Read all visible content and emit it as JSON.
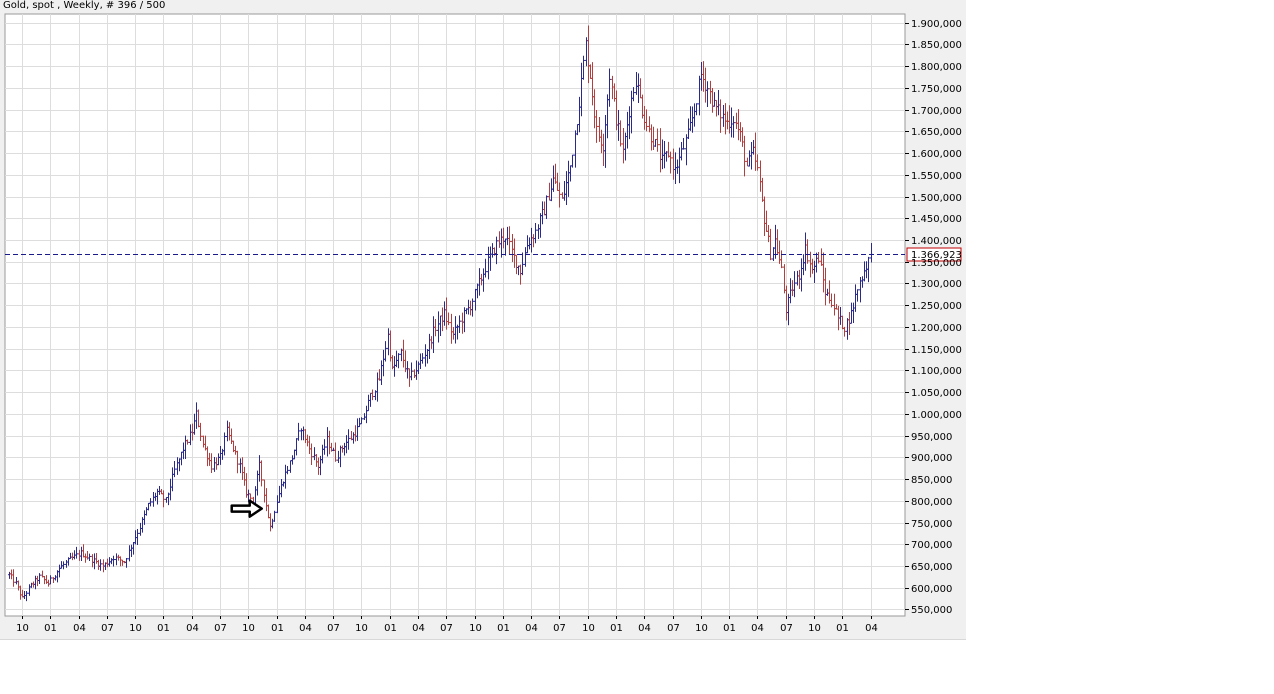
{
  "chart_title": "Gold, spot , Weekly, # 396 / 500",
  "colors": {
    "up_bar": "#2a2a8a",
    "down_bar": "#b04040",
    "grid": "#dddddd",
    "current_line": "#1a1a8c",
    "current_box_border": "#c00000"
  },
  "arrow_annotation": {
    "icon": "right-arrow-icon",
    "x_index": 118,
    "value": 782000
  },
  "chart_data": {
    "type": "ohlc",
    "title": "Gold, spot , Weekly, # 396 / 500",
    "ylim": [
      535000,
      1920000
    ],
    "y_ticks": [
      {
        "value": 550000,
        "label": "550,000"
      },
      {
        "value": 600000,
        "label": "600,000"
      },
      {
        "value": 650000,
        "label": "650,000"
      },
      {
        "value": 700000,
        "label": "700,000"
      },
      {
        "value": 750000,
        "label": "750,000"
      },
      {
        "value": 800000,
        "label": "800,000"
      },
      {
        "value": 850000,
        "label": "850,000"
      },
      {
        "value": 900000,
        "label": "900,000"
      },
      {
        "value": 950000,
        "label": "950,000"
      },
      {
        "value": 1000000,
        "label": "1.000,000"
      },
      {
        "value": 1050000,
        "label": "1.050,000"
      },
      {
        "value": 1100000,
        "label": "1.100,000"
      },
      {
        "value": 1150000,
        "label": "1.150,000"
      },
      {
        "value": 1200000,
        "label": "1.200,000"
      },
      {
        "value": 1250000,
        "label": "1.250,000"
      },
      {
        "value": 1300000,
        "label": "1.300,000"
      },
      {
        "value": 1350000,
        "label": "1.350,000"
      },
      {
        "value": 1400000,
        "label": "1.400,000"
      },
      {
        "value": 1450000,
        "label": "1.450,000"
      },
      {
        "value": 1500000,
        "label": "1.500,000"
      },
      {
        "value": 1550000,
        "label": "1.550,000"
      },
      {
        "value": 1600000,
        "label": "1.600,000"
      },
      {
        "value": 1650000,
        "label": "1.650,000"
      },
      {
        "value": 1700000,
        "label": "1.700,000"
      },
      {
        "value": 1750000,
        "label": "1.750,000"
      },
      {
        "value": 1800000,
        "label": "1.800,000"
      },
      {
        "value": 1850000,
        "label": "1.850,000"
      },
      {
        "value": 1900000,
        "label": "1.900,000"
      }
    ],
    "x_ticks": [
      {
        "index": 6,
        "label": "10"
      },
      {
        "index": 19,
        "label": "01"
      },
      {
        "index": 32,
        "label": "04"
      },
      {
        "index": 45,
        "label": "07"
      },
      {
        "index": 58,
        "label": "10"
      },
      {
        "index": 71,
        "label": "01"
      },
      {
        "index": 84,
        "label": "04"
      },
      {
        "index": 97,
        "label": "07"
      },
      {
        "index": 110,
        "label": "10"
      },
      {
        "index": 123,
        "label": "01"
      },
      {
        "index": 136,
        "label": "04"
      },
      {
        "index": 149,
        "label": "07"
      },
      {
        "index": 162,
        "label": "10"
      },
      {
        "index": 175,
        "label": "01"
      },
      {
        "index": 188,
        "label": "04"
      },
      {
        "index": 201,
        "label": "07"
      },
      {
        "index": 214,
        "label": "10"
      },
      {
        "index": 227,
        "label": "01"
      },
      {
        "index": 240,
        "label": "04"
      },
      {
        "index": 253,
        "label": "07"
      },
      {
        "index": 266,
        "label": "10"
      },
      {
        "index": 279,
        "label": "01"
      },
      {
        "index": 292,
        "label": "04"
      },
      {
        "index": 305,
        "label": "07"
      },
      {
        "index": 318,
        "label": "10"
      },
      {
        "index": 331,
        "label": "01"
      },
      {
        "index": 344,
        "label": "04"
      },
      {
        "index": 357,
        "label": "07"
      },
      {
        "index": 370,
        "label": "10"
      },
      {
        "index": 383,
        "label": "01"
      },
      {
        "index": 396,
        "label": "04"
      }
    ],
    "x_range": [
      0,
      410
    ],
    "current_value": 1366923,
    "current_label": "1.366,923",
    "anchors": [
      [
        0,
        630000
      ],
      [
        3,
        610000
      ],
      [
        6,
        575000
      ],
      [
        10,
        605000
      ],
      [
        14,
        625000
      ],
      [
        18,
        610000
      ],
      [
        23,
        645000
      ],
      [
        28,
        665000
      ],
      [
        33,
        680000
      ],
      [
        38,
        665000
      ],
      [
        43,
        650000
      ],
      [
        48,
        670000
      ],
      [
        53,
        660000
      ],
      [
        56,
        695000
      ],
      [
        60,
        740000
      ],
      [
        64,
        790000
      ],
      [
        68,
        820000
      ],
      [
        72,
        800000
      ],
      [
        76,
        870000
      ],
      [
        80,
        920000
      ],
      [
        84,
        960000
      ],
      [
        86,
        1000000
      ],
      [
        89,
        930000
      ],
      [
        93,
        880000
      ],
      [
        97,
        900000
      ],
      [
        100,
        960000
      ],
      [
        103,
        920000
      ],
      [
        106,
        880000
      ],
      [
        109,
        820000
      ],
      [
        112,
        800000
      ],
      [
        115,
        880000
      ],
      [
        118,
        790000
      ],
      [
        120,
        740000
      ],
      [
        123,
        800000
      ],
      [
        126,
        850000
      ],
      [
        130,
        900000
      ],
      [
        134,
        970000
      ],
      [
        138,
        920000
      ],
      [
        142,
        880000
      ],
      [
        146,
        940000
      ],
      [
        150,
        900000
      ],
      [
        154,
        930000
      ],
      [
        158,
        950000
      ],
      [
        162,
        980000
      ],
      [
        166,
        1040000
      ],
      [
        170,
        1080000
      ],
      [
        174,
        1180000
      ],
      [
        176,
        1100000
      ],
      [
        180,
        1140000
      ],
      [
        184,
        1080000
      ],
      [
        188,
        1110000
      ],
      [
        192,
        1150000
      ],
      [
        196,
        1200000
      ],
      [
        200,
        1230000
      ],
      [
        204,
        1180000
      ],
      [
        208,
        1220000
      ],
      [
        212,
        1250000
      ],
      [
        216,
        1300000
      ],
      [
        220,
        1350000
      ],
      [
        224,
        1390000
      ],
      [
        228,
        1410000
      ],
      [
        232,
        1360000
      ],
      [
        235,
        1330000
      ],
      [
        238,
        1390000
      ],
      [
        242,
        1420000
      ],
      [
        246,
        1470000
      ],
      [
        250,
        1540000
      ],
      [
        254,
        1490000
      ],
      [
        258,
        1570000
      ],
      [
        262,
        1720000
      ],
      [
        265,
        1850000
      ],
      [
        267,
        1780000
      ],
      [
        270,
        1650000
      ],
      [
        273,
        1620000
      ],
      [
        276,
        1780000
      ],
      [
        279,
        1680000
      ],
      [
        282,
        1600000
      ],
      [
        285,
        1700000
      ],
      [
        288,
        1770000
      ],
      [
        291,
        1700000
      ],
      [
        294,
        1650000
      ],
      [
        297,
        1620000
      ],
      [
        300,
        1580000
      ],
      [
        303,
        1600000
      ],
      [
        306,
        1560000
      ],
      [
        309,
        1600000
      ],
      [
        312,
        1640000
      ],
      [
        315,
        1700000
      ],
      [
        318,
        1780000
      ],
      [
        321,
        1750000
      ],
      [
        324,
        1710000
      ],
      [
        327,
        1690000
      ],
      [
        330,
        1670000
      ],
      [
        333,
        1680000
      ],
      [
        336,
        1640000
      ],
      [
        339,
        1570000
      ],
      [
        342,
        1600000
      ],
      [
        344,
        1560000
      ],
      [
        347,
        1450000
      ],
      [
        350,
        1370000
      ],
      [
        352,
        1400000
      ],
      [
        355,
        1330000
      ],
      [
        357,
        1240000
      ],
      [
        360,
        1290000
      ],
      [
        363,
        1320000
      ],
      [
        366,
        1380000
      ],
      [
        369,
        1330000
      ],
      [
        372,
        1360000
      ],
      [
        375,
        1280000
      ],
      [
        378,
        1260000
      ],
      [
        381,
        1220000
      ],
      [
        384,
        1200000
      ],
      [
        387,
        1230000
      ],
      [
        390,
        1290000
      ],
      [
        393,
        1330000
      ],
      [
        396,
        1366923
      ]
    ]
  }
}
